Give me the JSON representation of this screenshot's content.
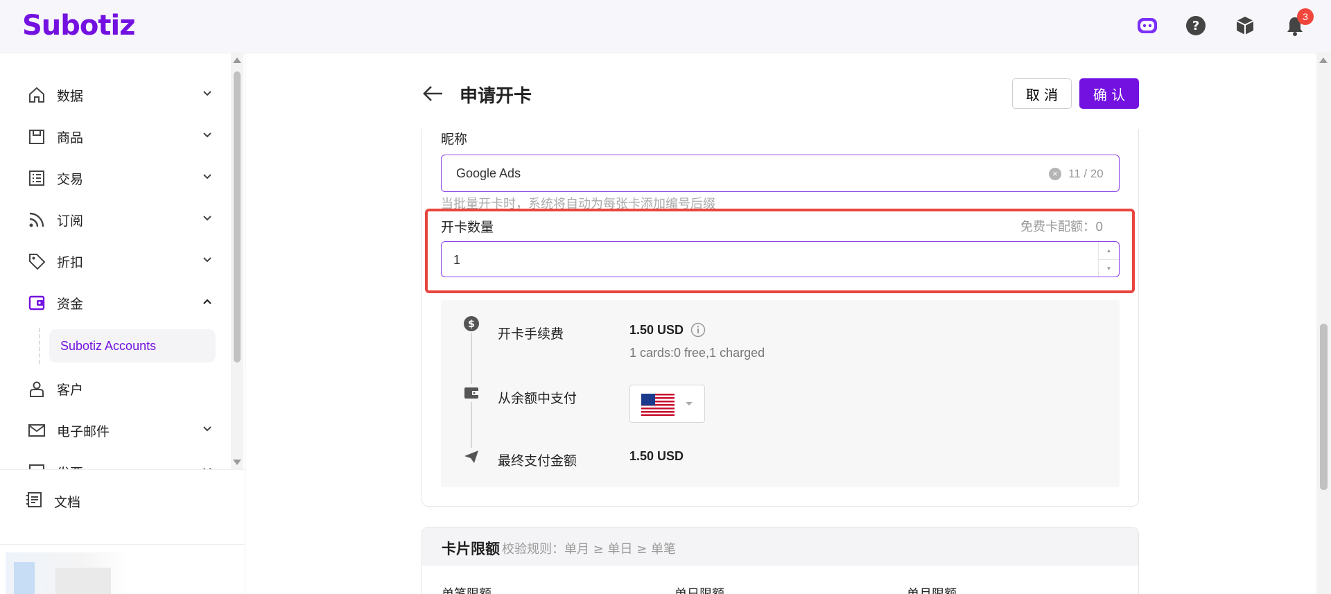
{
  "brand": {
    "logo": "Subotiz",
    "accent": "#7311e0"
  },
  "topbar": {
    "notification_count": "3"
  },
  "sidebar": {
    "items": [
      {
        "label": "数据",
        "icon": "home-icon"
      },
      {
        "label": "商品",
        "icon": "store-icon"
      },
      {
        "label": "交易",
        "icon": "list-icon"
      },
      {
        "label": "订阅",
        "icon": "rss-icon"
      },
      {
        "label": "折扣",
        "icon": "tag-icon"
      },
      {
        "label": "资金",
        "icon": "wallet-icon"
      },
      {
        "label": "客户",
        "icon": "user-icon"
      },
      {
        "label": "电子邮件",
        "icon": "mail-icon"
      },
      {
        "label": "发票",
        "icon": "invoice-icon"
      }
    ],
    "sub_item": "Subotiz Accounts",
    "docs": "文档"
  },
  "page": {
    "title": "申请开卡",
    "cancel": "取 消",
    "confirm": "确 认"
  },
  "form": {
    "nickname_label": "昵称",
    "nickname_value": "Google Ads",
    "nickname_count": "11 / 20",
    "nickname_hint": "当批量开卡时，系统将自动为每张卡添加编号后缀",
    "quantity_label": "开卡数量",
    "free_quota": "免费卡配额：0",
    "quantity_value": "1"
  },
  "fees": {
    "fee_label": "开卡手续费",
    "fee_value": "1.50 USD",
    "fee_detail": "1 cards:0 free,1 charged",
    "pay_label": "从余额中支付",
    "total_label": "最终支付金额",
    "total_value": "1.50 USD"
  },
  "limits": {
    "title": "卡片限额",
    "rule": "校验规则：单月 ≥ 单日 ≥ 单笔",
    "columns": [
      "单笔限额",
      "单日限额",
      "单月限额"
    ]
  }
}
